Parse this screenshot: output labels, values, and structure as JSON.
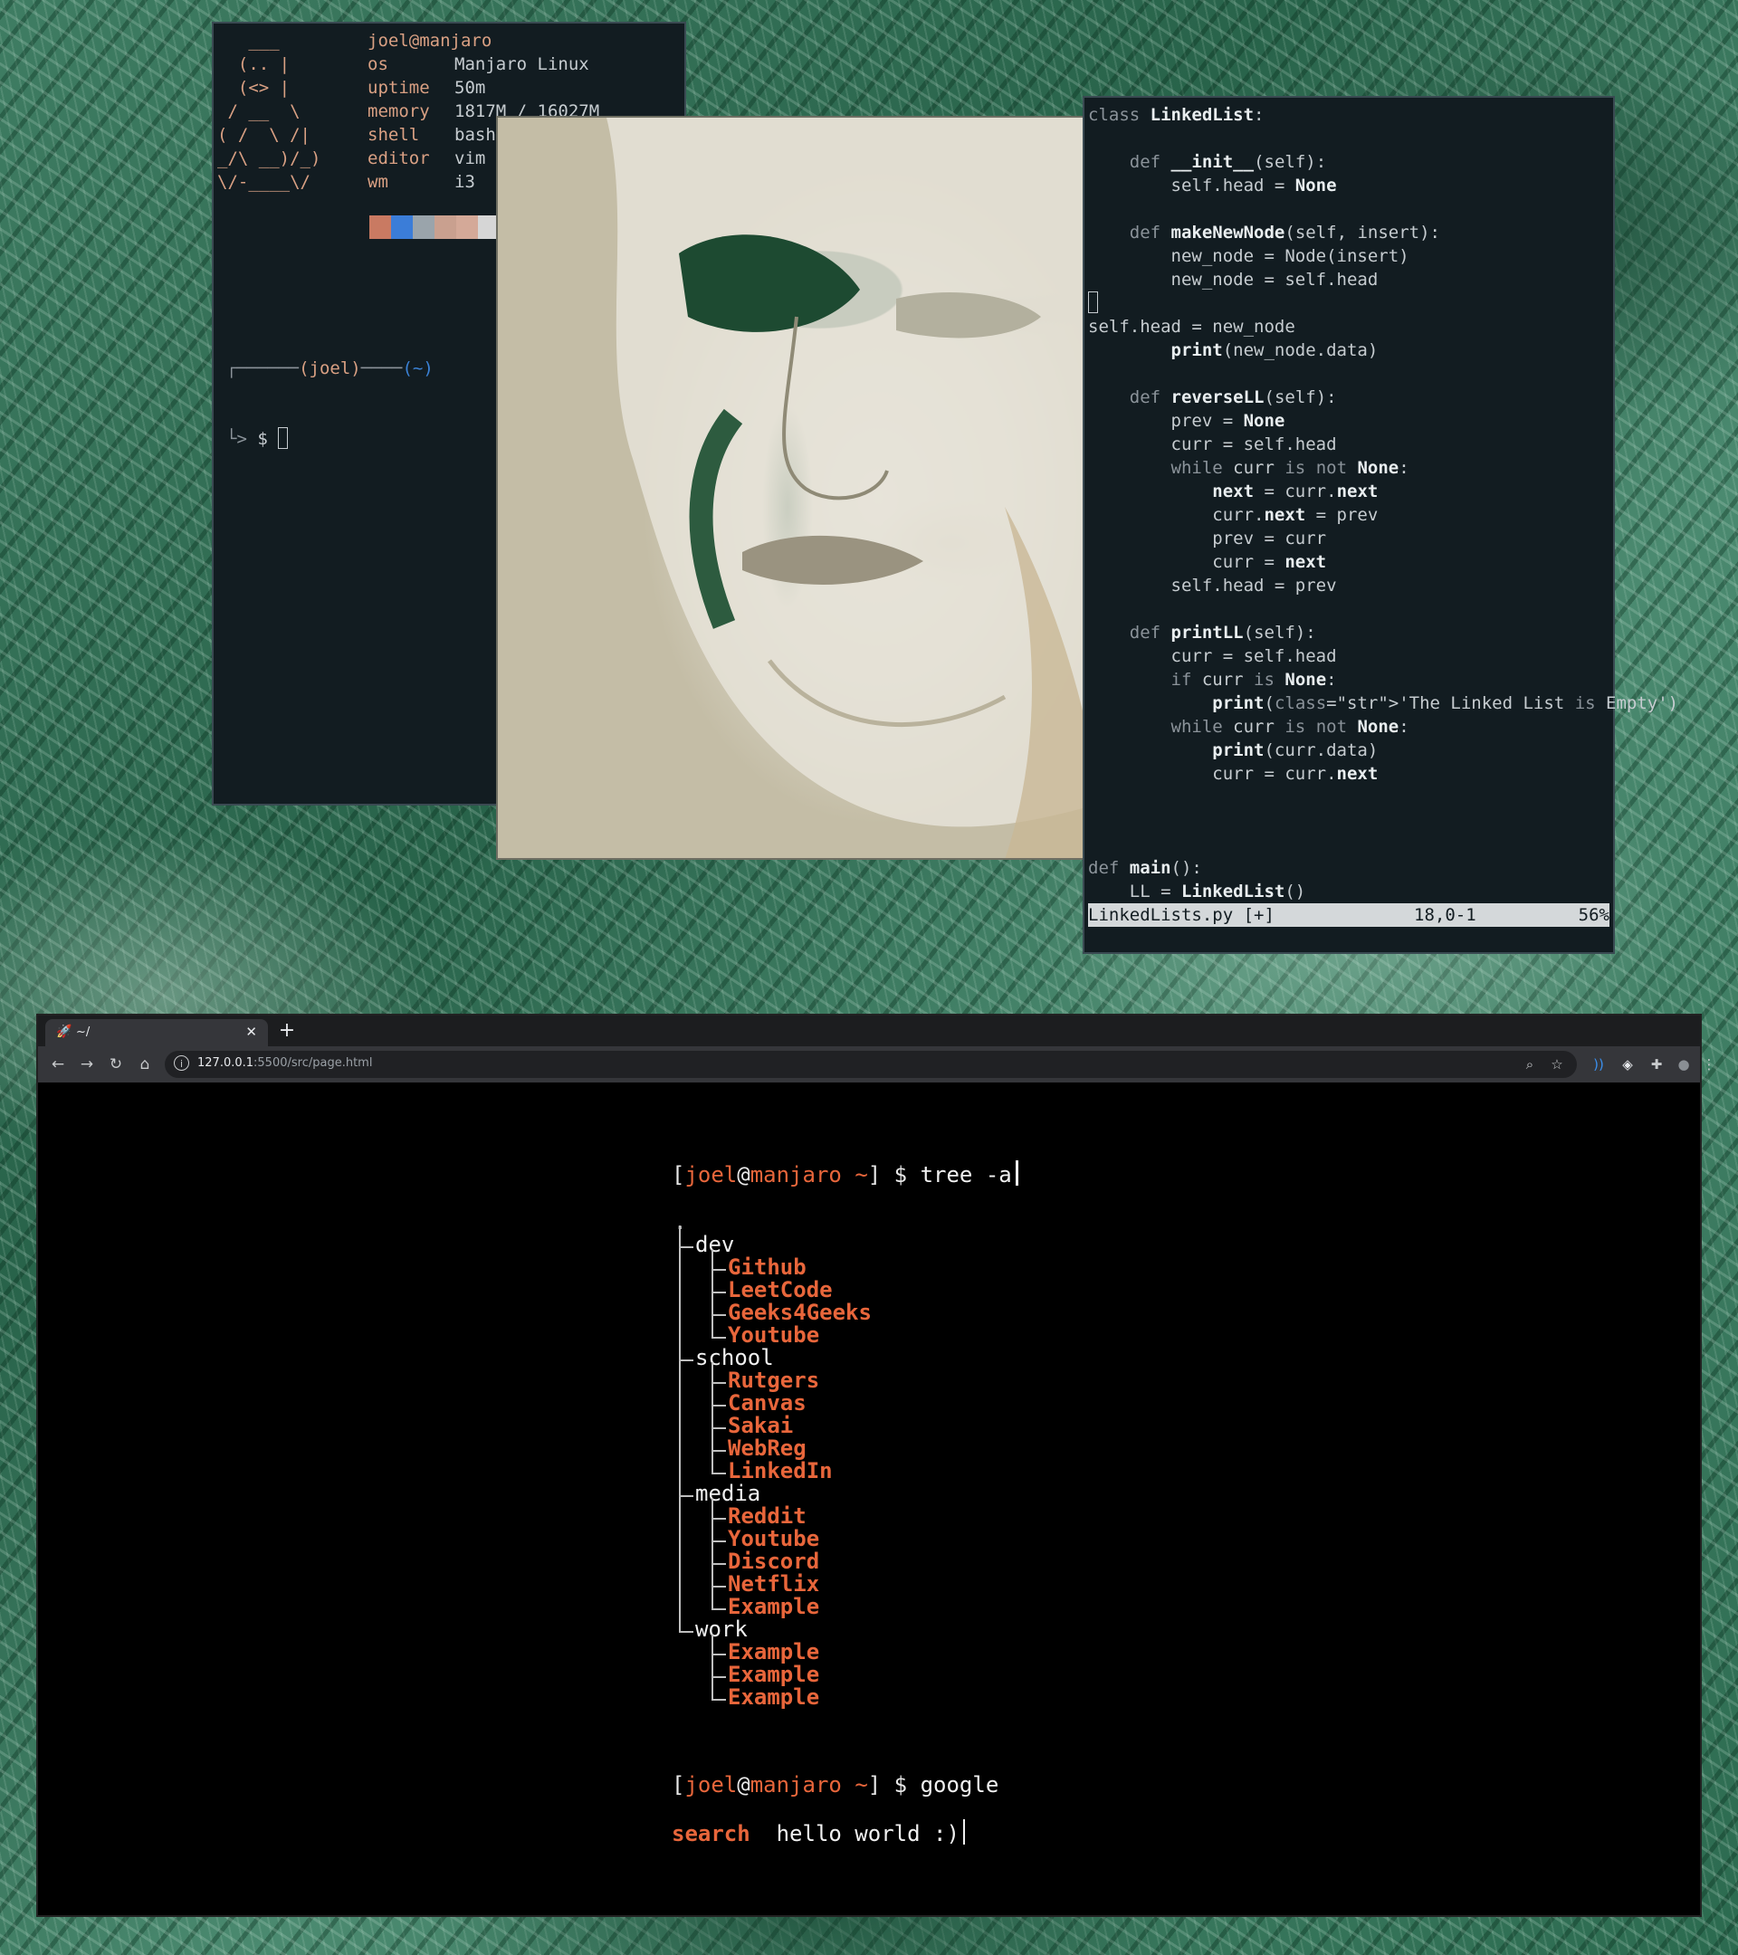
{
  "neofetch": {
    "ascii": "   ___\n  (.. |\n  (<> |\n / __  \\\n( /  \\ /|\n_/\\ __)/_)\n\\/-____\\/",
    "title": "joel@manjaro",
    "rows": [
      {
        "key": "os",
        "value": "Manjaro Linux"
      },
      {
        "key": "uptime",
        "value": "50m"
      },
      {
        "key": "memory",
        "value": "1817M / 16027M"
      },
      {
        "key": "shell",
        "value": "bash"
      },
      {
        "key": "editor",
        "value": "vim"
      },
      {
        "key": "wm",
        "value": "i3"
      }
    ],
    "swatch_colors": [
      "#c97a62",
      "#3b7dd8",
      "#9aa4ab",
      "#c9a08f",
      "#d4a998",
      "#d6d6d6"
    ],
    "prompt_user": "(joel)",
    "prompt_dir": "(~)",
    "prompt_symbol": "$"
  },
  "vim": {
    "lines": [
      "class LinkedList:",
      "",
      "    def __init__(self):",
      "        self.head = None",
      "",
      "    def makeNewNode(self, insert):",
      "        new_node = Node(insert)",
      "        new_node = self.head",
      "",
      "self.head = new_node",
      "        print(new_node.data)",
      "",
      "    def reverseLL(self):",
      "        prev = None",
      "        curr = self.head",
      "        while curr is not None:",
      "            next = curr.next",
      "            curr.next = prev",
      "            prev = curr",
      "            curr = next",
      "        self.head = prev",
      "",
      "    def printLL(self):",
      "        curr = self.head",
      "        if curr is None:",
      "            print('The Linked List is Empty')",
      "        while curr is not None:",
      "            print(curr.data)",
      "            curr = curr.next",
      "",
      "",
      "",
      "def main():",
      "    LL = LinkedList()"
    ],
    "status": {
      "file": "LinkedLists.py [+]",
      "position": "18,0-1",
      "percent": "56%"
    }
  },
  "browser": {
    "tab_title": "~/",
    "tab_icon": "rocket-icon",
    "url_host": "127.0.0.1",
    "url_path": ":5500/src/page.html",
    "page": {
      "prompt_open": "[",
      "user": "joel",
      "at": "@",
      "host": "manjaro",
      "dir": "~",
      "prompt_close": "]",
      "symbol": "$",
      "tree_cmd": "tree -a",
      "tree_root": ".",
      "folders": [
        {
          "name": "dev",
          "links": [
            "Github",
            "LeetCode",
            "Geeks4Geeks",
            "Youtube"
          ]
        },
        {
          "name": "school",
          "links": [
            "Rutgers",
            "Canvas",
            "Sakai",
            "WebReg",
            "LinkedIn"
          ]
        },
        {
          "name": "media",
          "links": [
            "Reddit",
            "Youtube",
            "Discord",
            "Netflix",
            "Example"
          ]
        },
        {
          "name": "work",
          "links": [
            "Example",
            "Example",
            "Example"
          ]
        }
      ],
      "google_cmd": "google",
      "search_label": "search",
      "search_value": "hello world :)"
    }
  },
  "colors": {
    "accent": "#e8663b",
    "terminal_bg": "#121c21",
    "neofetch_accent": "#d9a083"
  }
}
